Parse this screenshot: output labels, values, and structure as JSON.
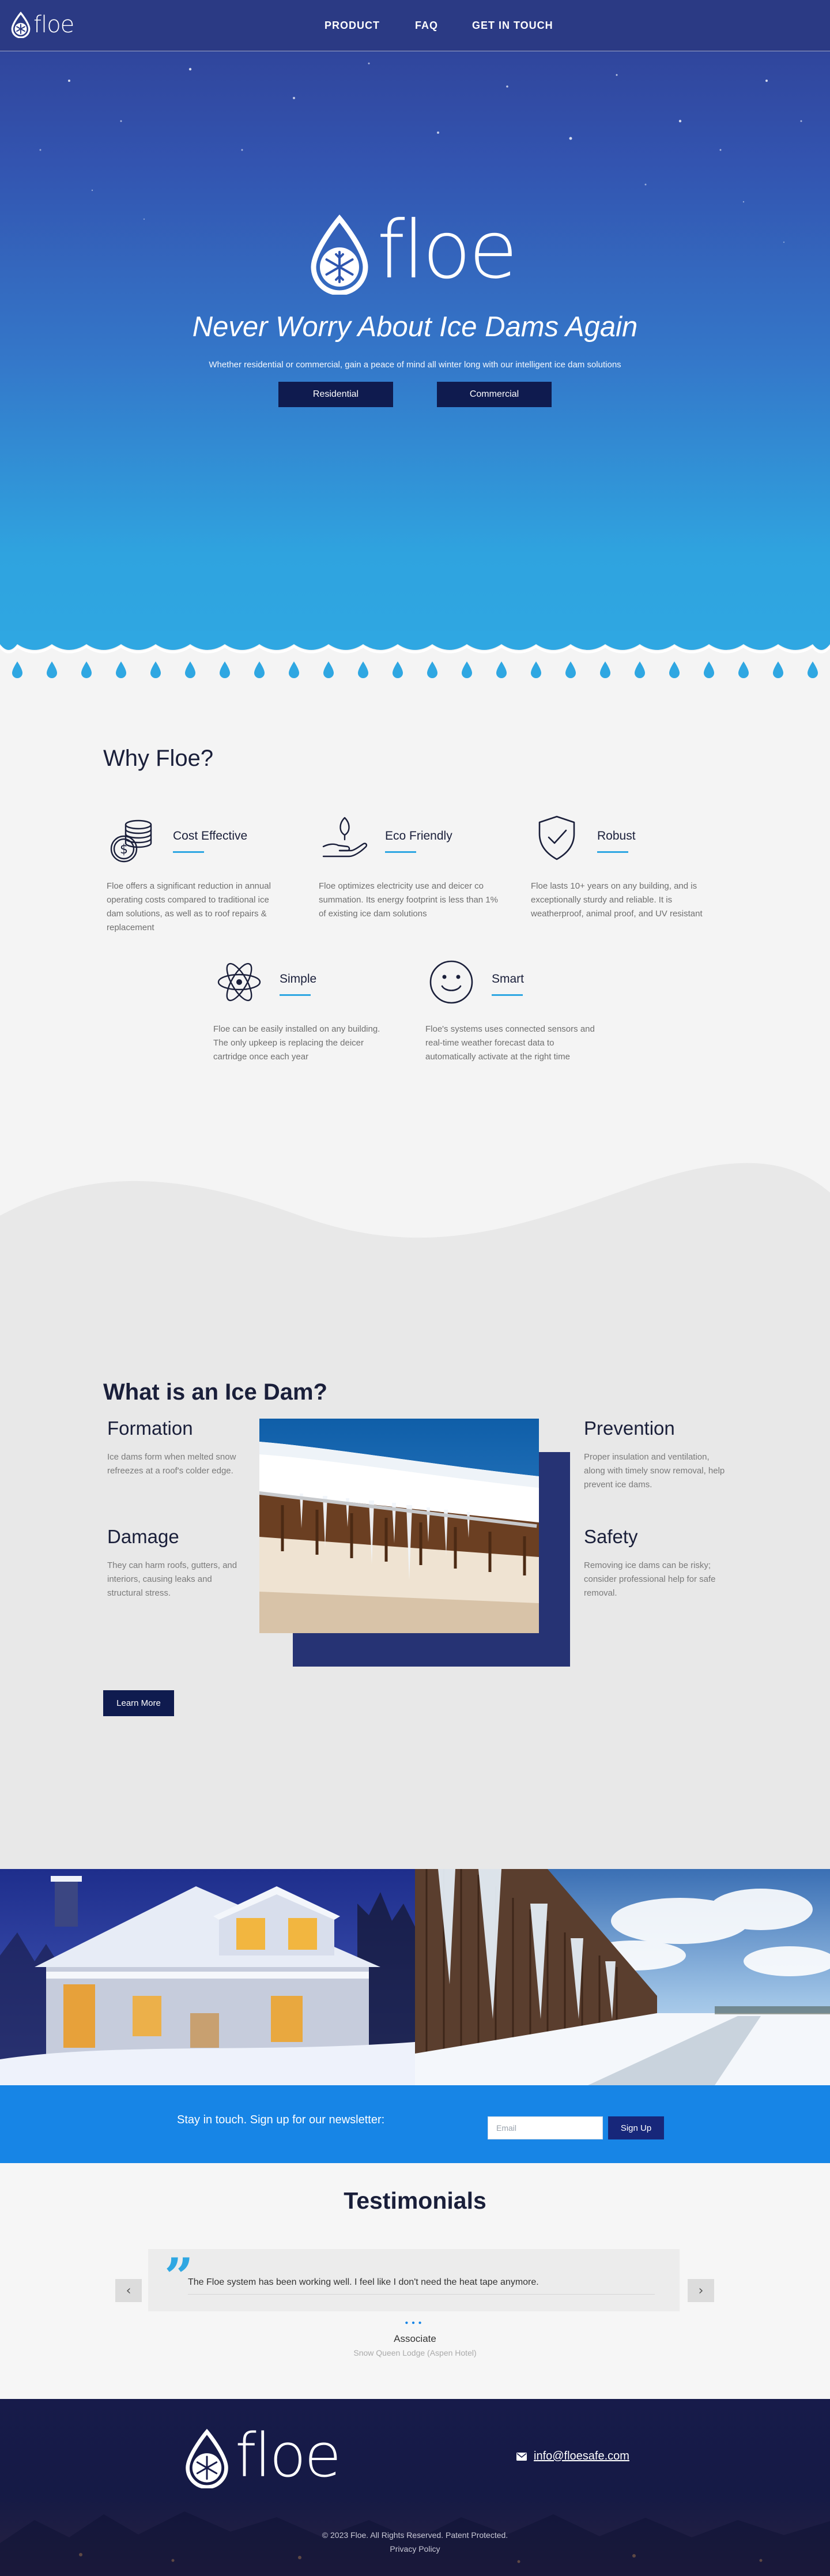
{
  "brand": {
    "name": "floe"
  },
  "nav": {
    "links": [
      "PRODUCT",
      "FAQ",
      "GET IN TOUCH"
    ]
  },
  "hero": {
    "title": "Never Worry About Ice Dams Again",
    "subtitle": "Whether residential or commercial, gain a peace of mind all winter long with our intelligent ice dam solutions",
    "buttons": [
      "Residential",
      "Commercial"
    ]
  },
  "why": {
    "title": "Why Floe?",
    "features": [
      {
        "name": "Cost Effective",
        "icon": "coins-icon",
        "desc": "Floe offers a significant reduction in annual operating costs compared to traditional ice dam solutions, as well as to roof repairs & replacement"
      },
      {
        "name": "Eco Friendly",
        "icon": "hand-leaf-icon",
        "desc": "Floe optimizes electricity use and deicer co summation. Its energy footprint is less than 1% of existing ice dam solutions"
      },
      {
        "name": "Robust",
        "icon": "shield-check-icon",
        "desc": "Floe lasts 10+ years on any building, and is exceptionally sturdy and reliable. It is weatherproof, animal proof, and UV resistant"
      },
      {
        "name": "Simple",
        "icon": "atom-icon",
        "desc": "Floe can be easily installed on any building. The only upkeep is replacing the deicer cartridge once each year"
      },
      {
        "name": "Smart",
        "icon": "smiley-icon",
        "desc": "Floe's systems uses connected sensors and real-time weather forecast data to automatically activate at the right time"
      }
    ]
  },
  "ice_dam": {
    "title": "What is an Ice Dam?",
    "items": [
      {
        "heading": "Formation",
        "text": "Ice dams form when melted snow refreezes at a roof's colder edge."
      },
      {
        "heading": "Damage",
        "text": "They can harm roofs, gutters, and interiors, causing leaks and structural stress."
      },
      {
        "heading": "Prevention",
        "text": "Proper insulation and ventilation, along with timely snow removal, help prevent ice dams."
      },
      {
        "heading": "Safety",
        "text": "Removing ice dams can be risky; consider professional help for safe removal."
      }
    ],
    "button": "Learn More"
  },
  "newsletter": {
    "text": "Stay in touch. Sign up for our newsletter:",
    "placeholder": "Email",
    "button": "Sign Up"
  },
  "testimonials": {
    "title": "Testimonials",
    "quote": "The Floe system has been working well. I feel like I don't need the heat tape anymore.",
    "author": "Associate",
    "org": "Snow Queen Lodge (Aspen Hotel)",
    "prev": "‹",
    "next": "›",
    "dots": "•••"
  },
  "footer": {
    "email": "info@floesafe.com",
    "copyright": "© 2023 Floe. All Rights Reserved. Patent Protected.",
    "privacy": "Privacy Policy"
  },
  "colors": {
    "nav": "#2b3a84",
    "accent": "#2fa7e2",
    "button": "#0f1b4f",
    "newsletter": "#1785e6",
    "footer": "#171b4a"
  }
}
